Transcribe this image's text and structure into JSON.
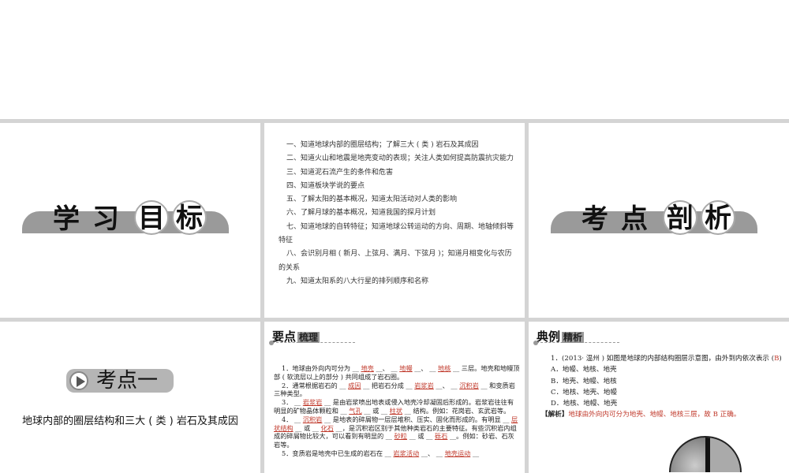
{
  "banner_goals": [
    "学",
    "习",
    "目",
    "标"
  ],
  "banner_analysis": [
    "考",
    "点",
    "剖",
    "析"
  ],
  "goals": [
    "一、知道地球内部的圈层结构；了解三大 ( 类 ) 岩石及其成因",
    "二、知道火山和地震是地壳变动的表现；关注人类如何提高防震抗灾能力",
    "三、知道泥石流产生的条件和危害",
    "四、知道板块学说的要点",
    "五、了解太阳的基本概况，知道太阳活动对人类的影响",
    "六、了解月球的基本概况，知道我国的探月计划",
    "七、知道地球的自转特征；知道地球公转运动的方向、周期、地轴倾斜等特征",
    "八、会识别月相 ( 新月、上弦月、满月、下弦月 )；知道月相变化与农历的关系",
    "九、知道太阳系的八大行星的排列顺序和名称"
  ],
  "kaodian": {
    "label": "考点一",
    "title": "地球内部的圈层结构和三大 ( 类 ) 岩石及其成因"
  },
  "yaodian": {
    "title": "要点",
    "title_box": "梳理",
    "paras": [
      [
        {
          "t": "1．地球由外向内可分为 __ "
        },
        {
          "t": "地壳",
          "f": 1
        },
        {
          "t": " __、 __ "
        },
        {
          "t": "地幔",
          "f": 1
        },
        {
          "t": " __、 __ "
        },
        {
          "t": "地核",
          "f": 1
        },
        {
          "t": " __ 三层。地壳和地幔顶部 ( 软流层以上的部分 ) 共同组成了岩石圈。"
        }
      ],
      [
        {
          "t": "2．通常根据岩石的 __ "
        },
        {
          "t": "成因",
          "f": 1
        },
        {
          "t": " __ 把岩石分成 __ "
        },
        {
          "t": "岩浆岩",
          "f": 1
        },
        {
          "t": " __、 __ "
        },
        {
          "t": "沉积岩",
          "f": 1
        },
        {
          "t": " __ 和变质岩三种类型。"
        }
      ],
      [
        {
          "t": "3． __ "
        },
        {
          "t": "岩浆岩",
          "f": 1
        },
        {
          "t": " __ 是由岩浆喷出地表或侵入地壳冷却凝固后形成的。岩浆岩往往有明显的矿物晶体颗粒和 __ "
        },
        {
          "t": "气孔",
          "f": 1
        },
        {
          "t": " __ 或 __ "
        },
        {
          "t": "柱状",
          "f": 1
        },
        {
          "t": " __ 结构。例如：花岗岩、玄武岩等。"
        }
      ],
      [
        {
          "t": "4． __ "
        },
        {
          "t": "沉积岩",
          "f": 1
        },
        {
          "t": " __ 是地表的碎屑物一层层堆积、压实、固化而形成的。有明显 __ "
        },
        {
          "t": "层状结构",
          "f": 1
        },
        {
          "t": " __ 或 __ "
        },
        {
          "t": "化石",
          "f": 1
        },
        {
          "t": " __，是沉积岩区别于其他种类岩石的主要特征。有些沉积岩内组成的碎屑物比较大，可以看到有明显的 __ "
        },
        {
          "t": "砂粒",
          "f": 1
        },
        {
          "t": " __ 或 __ "
        },
        {
          "t": "砾石",
          "f": 1
        },
        {
          "t": " __。例如：砂岩、石灰岩等。"
        }
      ],
      [
        {
          "t": "5．变质岩是地壳中已生成的岩石在 __ "
        },
        {
          "t": "岩浆活动",
          "f": 1
        },
        {
          "t": " __、 __ "
        },
        {
          "t": "地壳运动",
          "f": 1
        },
        {
          "t": " __"
        }
      ]
    ]
  },
  "dianli": {
    "title": "典例",
    "title_box": "精析",
    "q": "1．(2013· 温州 ) 如图是地球的内部结构圈层示意图，由外到内依次表示 (",
    "answer": "B",
    "q_end": ")",
    "options": [
      "A．地幔、地核、地壳",
      "B．地壳、地幔、地核",
      "C．地核、地壳、地幔",
      "D．地核、地幔、地壳"
    ],
    "analysis_label": "【解析】",
    "analysis": "地球由外向内可分为地壳、地幔、地核三层，故 B 正确。"
  }
}
